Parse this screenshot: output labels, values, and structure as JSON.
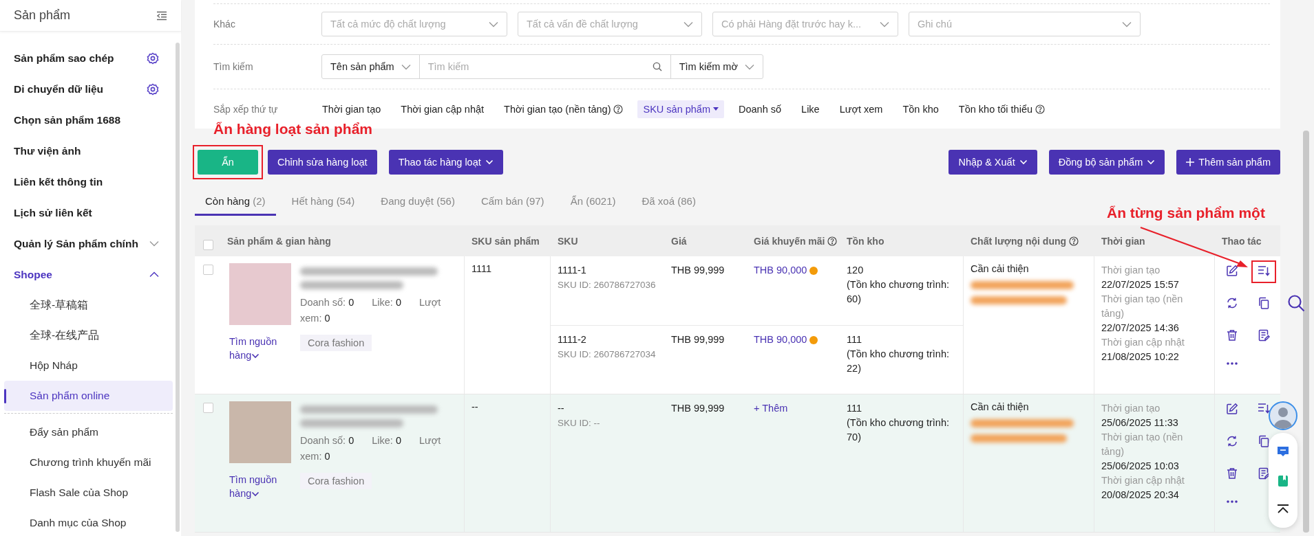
{
  "sidebar": {
    "title": "Sản phẩm",
    "items": [
      {
        "label": "Sản phẩm sao chép",
        "kind": "setting"
      },
      {
        "label": "Di chuyển dữ liệu",
        "kind": "setting"
      },
      {
        "label": "Chọn sản phẩm 1688",
        "kind": "link"
      },
      {
        "label": "Thư viện ảnh",
        "kind": "link"
      },
      {
        "label": "Liên kết thông tin",
        "kind": "link"
      },
      {
        "label": "Lịch sử liên kết",
        "kind": "link"
      },
      {
        "label": "Quản lý Sản phẩm chính",
        "kind": "group",
        "expanded": false
      },
      {
        "label": "Shopee",
        "kind": "group",
        "expanded": true,
        "children": [
          {
            "label": "全球-草稿箱",
            "selected": false
          },
          {
            "label": "全球-在线产品",
            "selected": false
          },
          {
            "label": "Hộp Nháp",
            "selected": false
          },
          {
            "label": "Sản phẩm online",
            "selected": true
          },
          {
            "label": "Đẩy sản phẩm",
            "selected": false,
            "separator_before": true
          },
          {
            "label": "Chương trình khuyến mãi",
            "selected": false
          },
          {
            "label": "Flash Sale của Shop",
            "selected": false
          },
          {
            "label": "Danh mục của Shop",
            "selected": false
          }
        ]
      }
    ]
  },
  "filters": {
    "other": {
      "label": "Khác",
      "selects": [
        {
          "placeholder": "Tất cả mức độ chất lượng"
        },
        {
          "placeholder": "Tất cả vấn đề chất lượng"
        },
        {
          "placeholder": "Có phải Hàng đặt trước hay k..."
        },
        {
          "placeholder": "Ghi chú"
        }
      ]
    },
    "search": {
      "label": "Tìm kiếm",
      "field": "Tên sản phẩm",
      "placeholder": "Tìm kiếm",
      "mode": "Tìm kiếm mờ"
    },
    "sort": {
      "label": "Sắp xếp thứ tự",
      "options": [
        {
          "label": "Thời gian tạo",
          "selected": false,
          "help": false
        },
        {
          "label": "Thời gian cập nhật",
          "selected": false,
          "help": false
        },
        {
          "label": "Thời gian tạo (nền tảng)",
          "selected": false,
          "help": true
        },
        {
          "label": "SKU sản phẩm",
          "selected": true,
          "help": false
        },
        {
          "label": "Doanh số",
          "selected": false,
          "help": false
        },
        {
          "label": "Like",
          "selected": false,
          "help": false
        },
        {
          "label": "Lượt xem",
          "selected": false,
          "help": false
        },
        {
          "label": "Tồn kho",
          "selected": false,
          "help": false
        },
        {
          "label": "Tồn kho tối thiểu",
          "selected": false,
          "help": true
        }
      ]
    }
  },
  "annotations": [
    {
      "text": "Ẩn hàng loạt sản phẩm"
    },
    {
      "text": "Ẩn từng sản phẩm một"
    }
  ],
  "toolbar": {
    "left": [
      {
        "label": "Ẩn",
        "kind": "primary",
        "highlighted": true
      },
      {
        "label": "Chỉnh sửa hàng loạt",
        "kind": "accent",
        "highlighted": false
      },
      {
        "label": "Thao tác hàng loạt",
        "kind": "dropdown",
        "highlighted": false
      }
    ],
    "right": [
      {
        "label": "Nhập & Xuất",
        "kind": "dropdown",
        "highlighted": false
      },
      {
        "label": "Đồng bộ sản phẩm",
        "kind": "dropdown",
        "highlighted": false
      },
      {
        "label": "Thêm sản phẩm",
        "kind": "add",
        "highlighted": false
      }
    ]
  },
  "tabs": [
    {
      "label": "Còn hàng",
      "count": "(2)",
      "selected": true
    },
    {
      "label": "Hết hàng",
      "count": "(54)",
      "selected": false
    },
    {
      "label": "Đang duyệt",
      "count": "(56)",
      "selected": false
    },
    {
      "label": "Cấm bán",
      "count": "(97)",
      "selected": false
    },
    {
      "label": "Ẩn",
      "count": "(6021)",
      "selected": false
    },
    {
      "label": "Đã xoá",
      "count": "(86)",
      "selected": false
    }
  ],
  "table": {
    "select_all": {
      "checked": false
    },
    "columns": [
      {
        "label": "Sản phẩm & gian hàng",
        "help": false
      },
      {
        "label": "SKU sản phẩm",
        "help": false
      },
      {
        "label": "SKU",
        "help": false
      },
      {
        "label": "Giá",
        "help": false
      },
      {
        "label": "Giá khuyến mãi",
        "help": true
      },
      {
        "label": "Tồn kho",
        "help": false
      },
      {
        "label": "Chất lượng nội dung",
        "help": true
      },
      {
        "label": "Thời gian",
        "help": false
      },
      {
        "label": "Thao tác",
        "help": false
      }
    ],
    "rows": [
      {
        "checked": false,
        "hovered": false,
        "stats": [
          {
            "label": "Doanh số:",
            "value": "0"
          },
          {
            "label": "Like:",
            "value": "0"
          },
          {
            "label": "Lượt xem:",
            "value": "0"
          }
        ],
        "source_link": "Tìm nguồn hàng",
        "shop": "Cora fashion",
        "product_sku": "1111",
        "variants": [
          {
            "sku": "1111-1",
            "sku_id": "SKU ID: 260786727036",
            "price": "THB 99,999",
            "promo": {
              "text": "THB 90,000",
              "warning": true
            },
            "stock": "120",
            "stock_note": "(Tồn kho chương trình: 60)"
          },
          {
            "sku": "1111-2",
            "sku_id": "SKU ID: 260786727034",
            "price": "THB 99,999",
            "promo": {
              "text": "THB 90,000",
              "warning": true
            },
            "stock": "111",
            "stock_note": "(Tồn kho chương trình: 22)"
          }
        ],
        "quality": "Cần cải thiện",
        "times": [
          {
            "label": "Thời gian tạo",
            "value": "22/07/2025 15:57"
          },
          {
            "label": "Thời gian tạo (nền tảng)",
            "value": "22/07/2025 14:36"
          },
          {
            "label": "Thời gian cập nhật",
            "value": "21/08/2025 10:22"
          }
        ],
        "hide_action": {
          "highlighted": true
        }
      },
      {
        "checked": false,
        "hovered": true,
        "stats": [
          {
            "label": "Doanh số:",
            "value": "0"
          },
          {
            "label": "Like:",
            "value": "0"
          },
          {
            "label": "Lượt xem:",
            "value": "0"
          }
        ],
        "source_link": "Tìm nguồn hàng",
        "shop": "Cora fashion",
        "product_sku": "--",
        "variants": [
          {
            "sku": "--",
            "sku_id": "SKU ID: --",
            "price": "THB 99,999",
            "promo": {
              "text": "+ Thêm",
              "warning": false
            },
            "stock": "111",
            "stock_note": "(Tồn kho chương trình: 70)"
          }
        ],
        "quality": "Cần cải thiện",
        "times": [
          {
            "label": "Thời gian tạo",
            "value": "25/06/2025 11:33"
          },
          {
            "label": "Thời gian tạo (nền tảng)",
            "value": "25/06/2025 10:03"
          },
          {
            "label": "Thời gian cập nhật",
            "value": "20/08/2025 20:34"
          }
        ],
        "hide_action": {
          "highlighted": false
        }
      }
    ]
  }
}
